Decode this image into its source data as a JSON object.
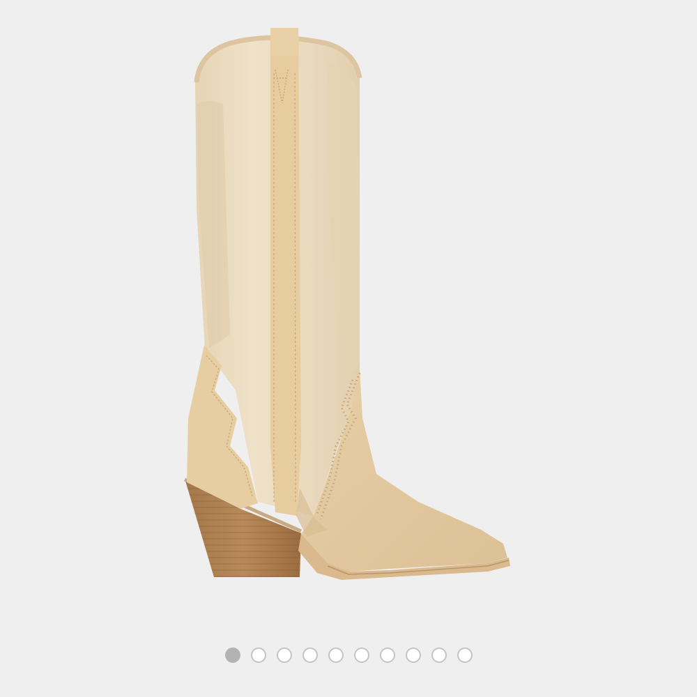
{
  "gallery": {
    "image_subject": "cowboy-boot",
    "background": "#efefef",
    "pager": {
      "total": 10,
      "active_index": 0,
      "active_color": "#b3b3b3",
      "inactive_border": "#c4c4c4"
    }
  }
}
